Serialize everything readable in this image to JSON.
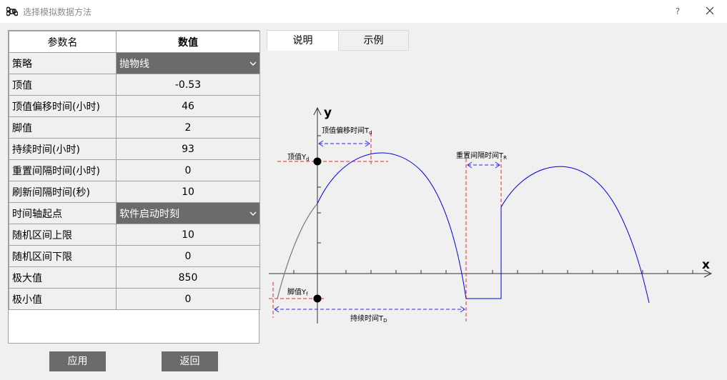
{
  "window": {
    "title": "选择模拟数据方法",
    "help_label": "?"
  },
  "table": {
    "header_name": "参数名",
    "header_value": "数值",
    "rows": [
      {
        "name": "策略",
        "value": "抛物线",
        "type": "combo"
      },
      {
        "name": "顶值",
        "value": "-0.53"
      },
      {
        "name": "顶值偏移时间(小时)",
        "value": "46"
      },
      {
        "name": "脚值",
        "value": "2"
      },
      {
        "name": "持续时间(小时)",
        "value": "93"
      },
      {
        "name": "重置间隔时间(小时)",
        "value": "0"
      },
      {
        "name": "刷新间隔时间(秒)",
        "value": "10"
      },
      {
        "name": "时间轴起点",
        "value": "软件启动时刻",
        "type": "combo"
      },
      {
        "name": "随机区间上限",
        "value": "10"
      },
      {
        "name": "随机区间下限",
        "value": "0"
      },
      {
        "name": "极大值",
        "value": "850"
      },
      {
        "name": "极小值",
        "value": "0"
      }
    ]
  },
  "buttons": {
    "apply": "应用",
    "back": "返回"
  },
  "tabs": [
    {
      "label": "说明",
      "active": true
    },
    {
      "label": "示例",
      "active": false
    }
  ],
  "diagram": {
    "y_axis": "y",
    "x_axis": "x",
    "peak_offset_label": "顶值偏移时间T",
    "peak_offset_sub": "d",
    "peak_label": "顶值Y",
    "peak_sub": "d",
    "reset_label": "重置间隔时间T",
    "reset_sub": "R",
    "foot_label": "脚值Y",
    "foot_sub": "f",
    "duration_label": "持续时间T",
    "duration_sub": "D"
  },
  "colors": {
    "curve": "#0000e0",
    "guide": "#e03030",
    "dimension": "#3030e0",
    "combo_bg": "#6b6b6b",
    "button_bg": "#6b6b6b"
  }
}
